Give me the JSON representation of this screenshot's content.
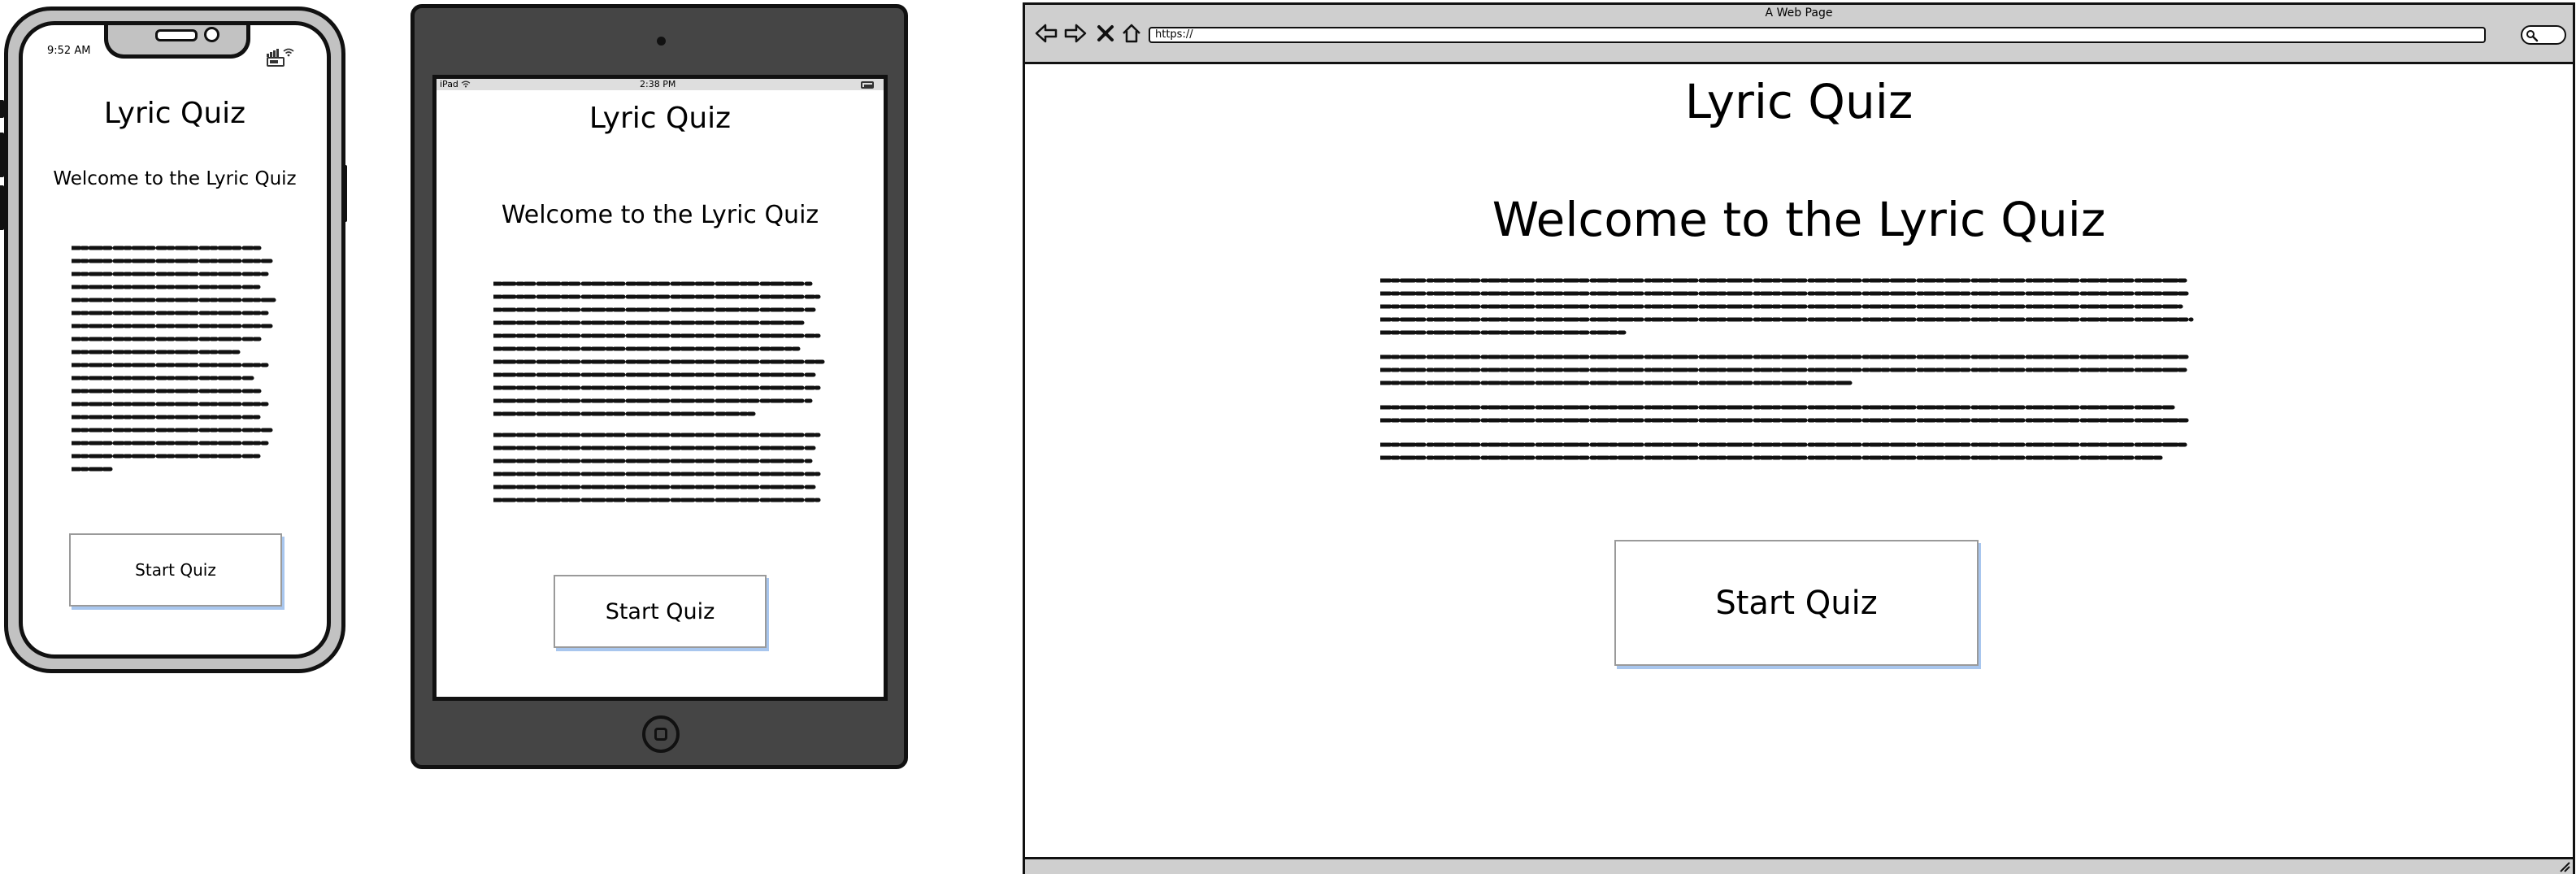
{
  "phone": {
    "status_time": "9:52 AM",
    "title": "Lyric Quiz",
    "welcome": "Welcome to the Lyric Quiz",
    "button_label": "Start Quiz"
  },
  "tablet": {
    "status_device": "iPad",
    "status_time": "2:38 PM",
    "title": "Lyric Quiz",
    "welcome": "Welcome to the Lyric Quiz",
    "button_label": "Start Quiz"
  },
  "browser": {
    "window_title": "A Web Page",
    "url": "https://",
    "title": "Lyric Quiz",
    "welcome": "Welcome to the Lyric Quiz",
    "button_label": "Start Quiz"
  },
  "colors": {
    "button_shadow": "#a8c6ee",
    "tablet_body": "#454545",
    "phone_body": "#c2c2c2",
    "chrome": "#cfcfcf"
  },
  "icons": [
    "back-icon",
    "forward-icon",
    "stop-icon",
    "home-icon",
    "search-icon",
    "wifi-icon",
    "battery-icon",
    "signal-icon",
    "resize-icon"
  ]
}
